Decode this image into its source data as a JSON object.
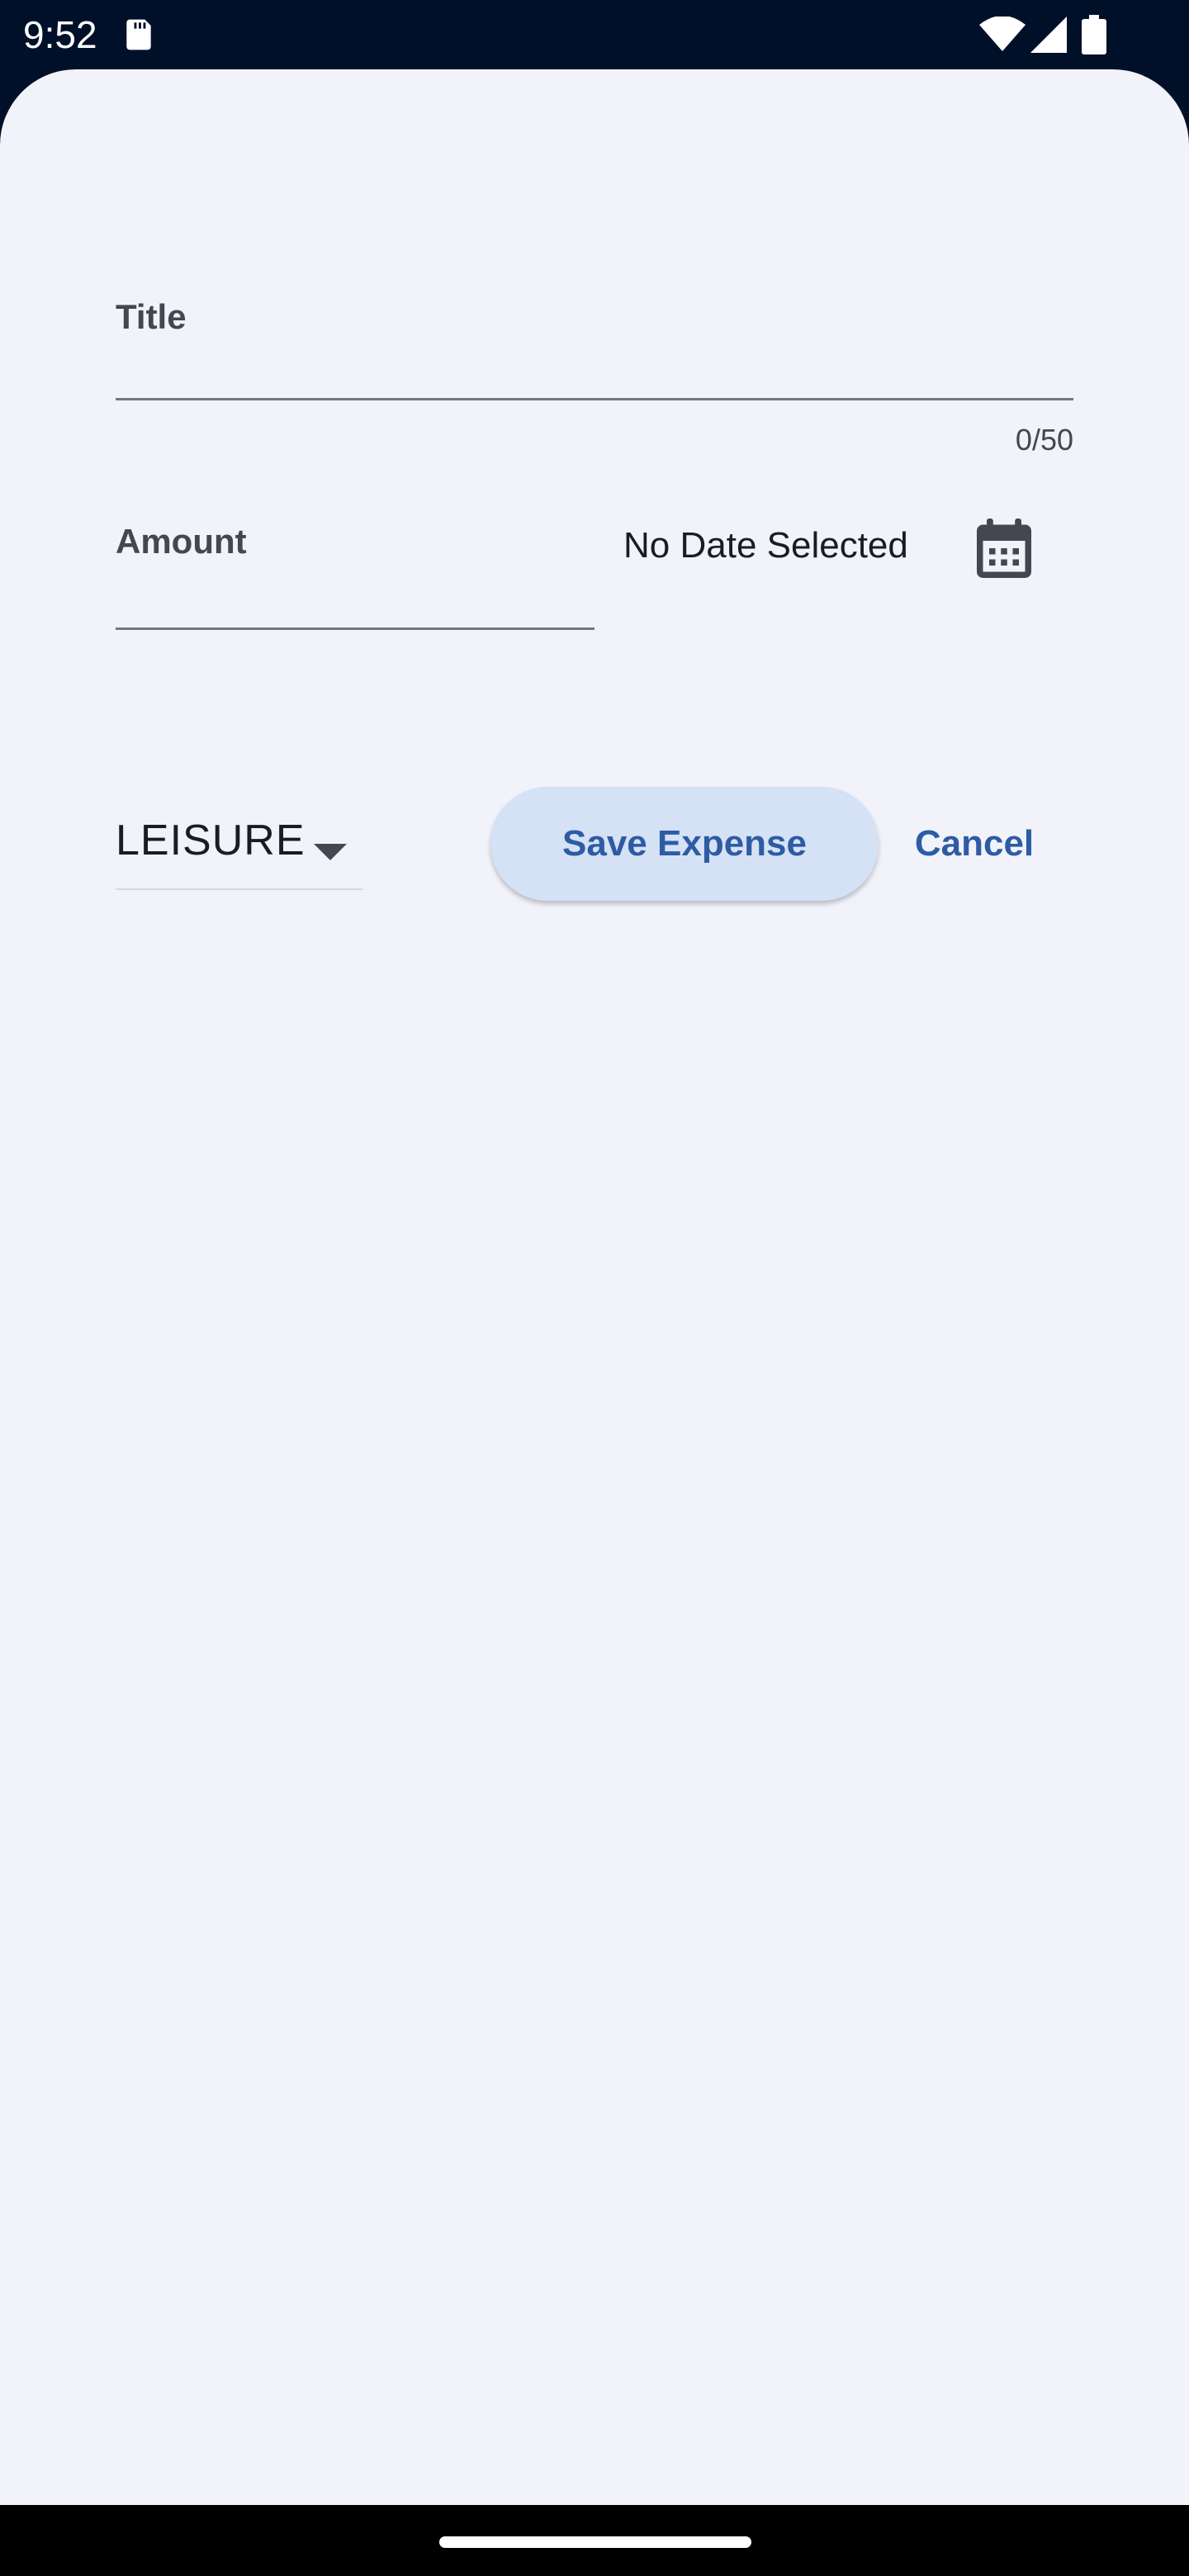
{
  "status_bar": {
    "time": "9:52",
    "icons": [
      "sd-card-icon",
      "wifi-icon",
      "signal-icon",
      "battery-icon"
    ]
  },
  "form": {
    "title_label": "Title",
    "title_value": "",
    "title_counter": "0/50",
    "amount_label": "Amount",
    "amount_value": "",
    "date_text": "No Date Selected",
    "date_icon": "calendar-icon",
    "category_selected": "LEISURE",
    "category_icon": "dropdown-arrow-icon",
    "save_label": "Save Expense",
    "cancel_label": "Cancel"
  },
  "colors": {
    "status_bar_bg": "#011029",
    "sheet_bg": "#f1f2fa",
    "accent": "#2d5ca3",
    "save_button_bg": "#d5e1f5",
    "label_text": "#44474f",
    "underline": "#74777f"
  }
}
